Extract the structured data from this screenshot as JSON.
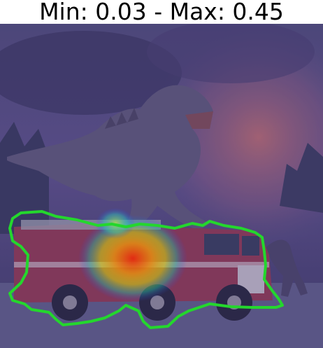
{
  "title": "Min: 0.03 - Max: 0.45",
  "overlay": {
    "tint_color": "#4a3f8f",
    "contour_color": "#22ee22",
    "heatmap_peak_color": "#ff2a00",
    "heatmap_low_color": "#2244ff"
  },
  "scene": {
    "subject": "dinosaur-and-fire-truck"
  }
}
